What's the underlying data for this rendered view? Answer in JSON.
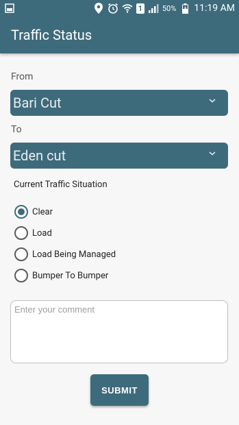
{
  "status_bar": {
    "battery_percent": "50%",
    "time": "11:19 AM",
    "sim_number": "1",
    "icons": [
      "gallery-icon",
      "location-icon",
      "alarm-icon",
      "wifi-icon",
      "sim-icon",
      "signal-icon",
      "battery-charging-icon"
    ]
  },
  "app_bar": {
    "title": "Traffic Status",
    "color": "#3e6b7c"
  },
  "form": {
    "from_label": "From",
    "from_value": "Bari Cut",
    "to_label": "To",
    "to_value": "Eden cut",
    "situation_label": "Current Traffic Situation",
    "options": [
      {
        "label": "Clear",
        "checked": true
      },
      {
        "label": "Load",
        "checked": false
      },
      {
        "label": "Load Being Managed",
        "checked": false
      },
      {
        "label": "Bumper To Bumper",
        "checked": false
      }
    ],
    "comment_placeholder": "Enter your comment",
    "submit_label": "SUBMIT"
  }
}
